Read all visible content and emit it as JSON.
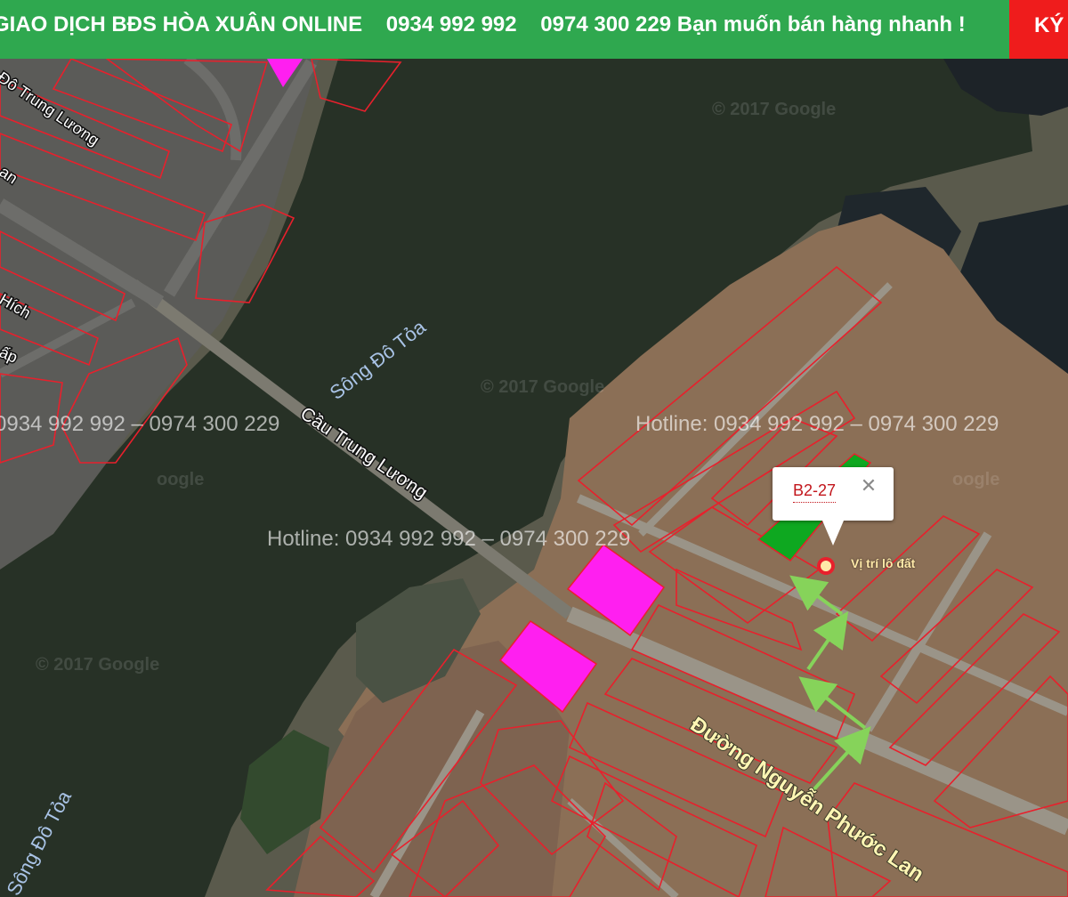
{
  "banner": {
    "text": "GIAO DỊCH BĐS HÒA XUÂN ONLINE    0934 992 992    0974 300 229 Bạn muốn bán hàng nhanh !",
    "cta": "KÝ",
    "background": "#2fa84f",
    "cta_background": "#ef1c1c"
  },
  "map": {
    "river_labels": [
      "Sông Đô Tỏa",
      "Sông Đô Tỏa"
    ],
    "bridge_label": "Cầu Trung Lương",
    "road_label": "Đường Nguyễn Phước Lan",
    "street_fragments": [
      "Đô Trung Lương",
      "an",
      "Hích",
      "ấp"
    ],
    "hotlines": [
      "Hotline: 0934 992 992 – 0974 300 229",
      "Hotline: 0934 992 992 – 0974 300 229",
      "0934 992 992 – 0974 300 229"
    ],
    "watermarks": [
      "© 2017 Google",
      "© 2017 Google",
      "oogle",
      "oogle",
      "© 2017 Google"
    ],
    "plot_outline_color": "#e8202c",
    "highlight_color": "#ff1ff0",
    "selected_lot_color": "#0ea820",
    "route_arrow_color": "#86d35a"
  },
  "popup": {
    "lot_id": "B2-27",
    "close_icon": "close-icon"
  },
  "marker": {
    "label": "Vị trí lô đất",
    "icon": "location-pin-icon"
  }
}
